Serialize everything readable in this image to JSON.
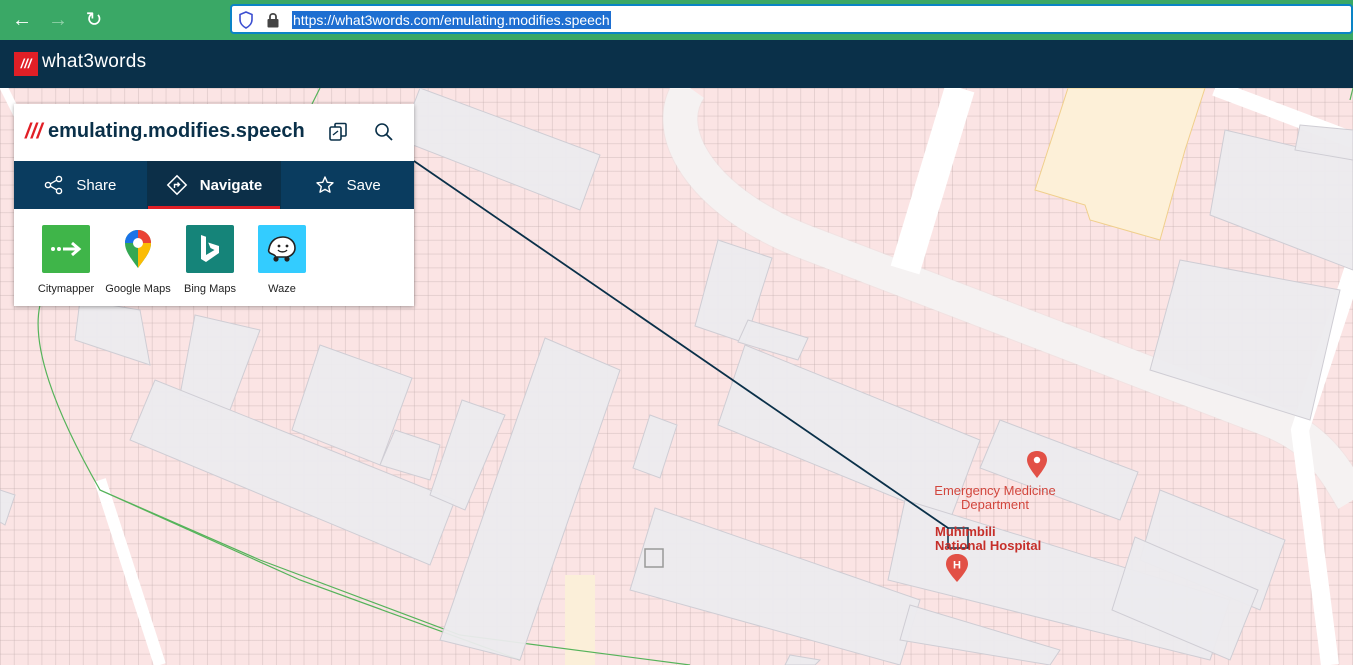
{
  "browser": {
    "url": "https://what3words.com/emulating.modifies.speech"
  },
  "header": {
    "logo_mark": "///",
    "brand": "what3words"
  },
  "card": {
    "slashes": "///",
    "address": "emulating.modifies.speech",
    "tabs": [
      {
        "label": "Share",
        "icon": "share-icon"
      },
      {
        "label": "Navigate",
        "icon": "navigate-icon",
        "active": true
      },
      {
        "label": "Save",
        "icon": "star-icon"
      }
    ],
    "apps": [
      {
        "label": "Citymapper",
        "color": "#3fb549"
      },
      {
        "label": "Google Maps",
        "color": "#ffffff"
      },
      {
        "label": "Bing Maps",
        "color": "#158479"
      },
      {
        "label": "Waze",
        "color": "#33ccff"
      }
    ]
  },
  "map": {
    "poi_emergency": "Emergency Medicine Department",
    "poi_hospital_line1": "Muhimbili",
    "poi_hospital_line2": "National Hospital"
  },
  "colors": {
    "brand_red": "#e11f26",
    "navy": "#0a3049",
    "browser_green": "#3aa866",
    "poi_red": "#d2463d"
  }
}
